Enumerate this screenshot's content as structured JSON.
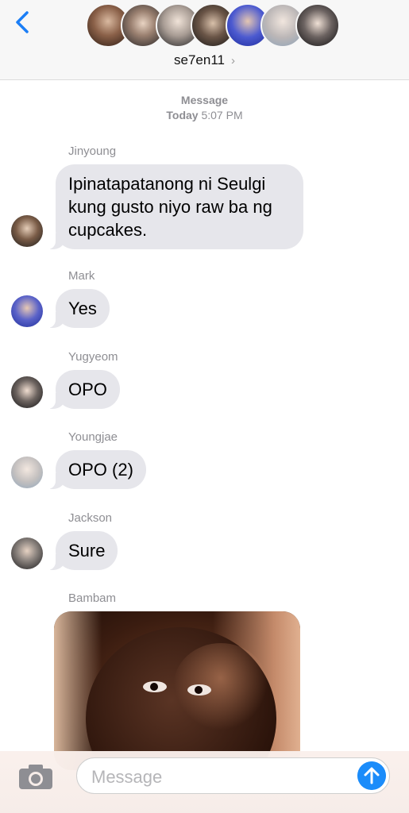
{
  "header": {
    "group_name": "se7en11",
    "chevron": "›",
    "back_icon": "chevron-left-icon",
    "accent_color": "#1b7ef6"
  },
  "timestamp": {
    "label": "Message",
    "day": "Today",
    "time": "5:07 PM"
  },
  "messages": [
    {
      "sender": "Jinyoung",
      "text": "Ipinatapatanong ni Seulgi kung gusto niyo raw ba ng cupcakes."
    },
    {
      "sender": "Mark",
      "text": "Yes"
    },
    {
      "sender": "Yugyeom",
      "text": "OPO"
    },
    {
      "sender": "Youngjae",
      "text": "OPO (2)"
    },
    {
      "sender": "Jackson",
      "text": "Sure"
    },
    {
      "sender": "Bambam",
      "text": ""
    }
  ],
  "composer": {
    "placeholder": "Message",
    "camera_icon": "camera-icon",
    "send_icon": "arrow-up-icon",
    "send_color": "#1b8cfa"
  },
  "colors": {
    "bubble": "#e6e6eb",
    "meta_text": "#8e8e93"
  }
}
